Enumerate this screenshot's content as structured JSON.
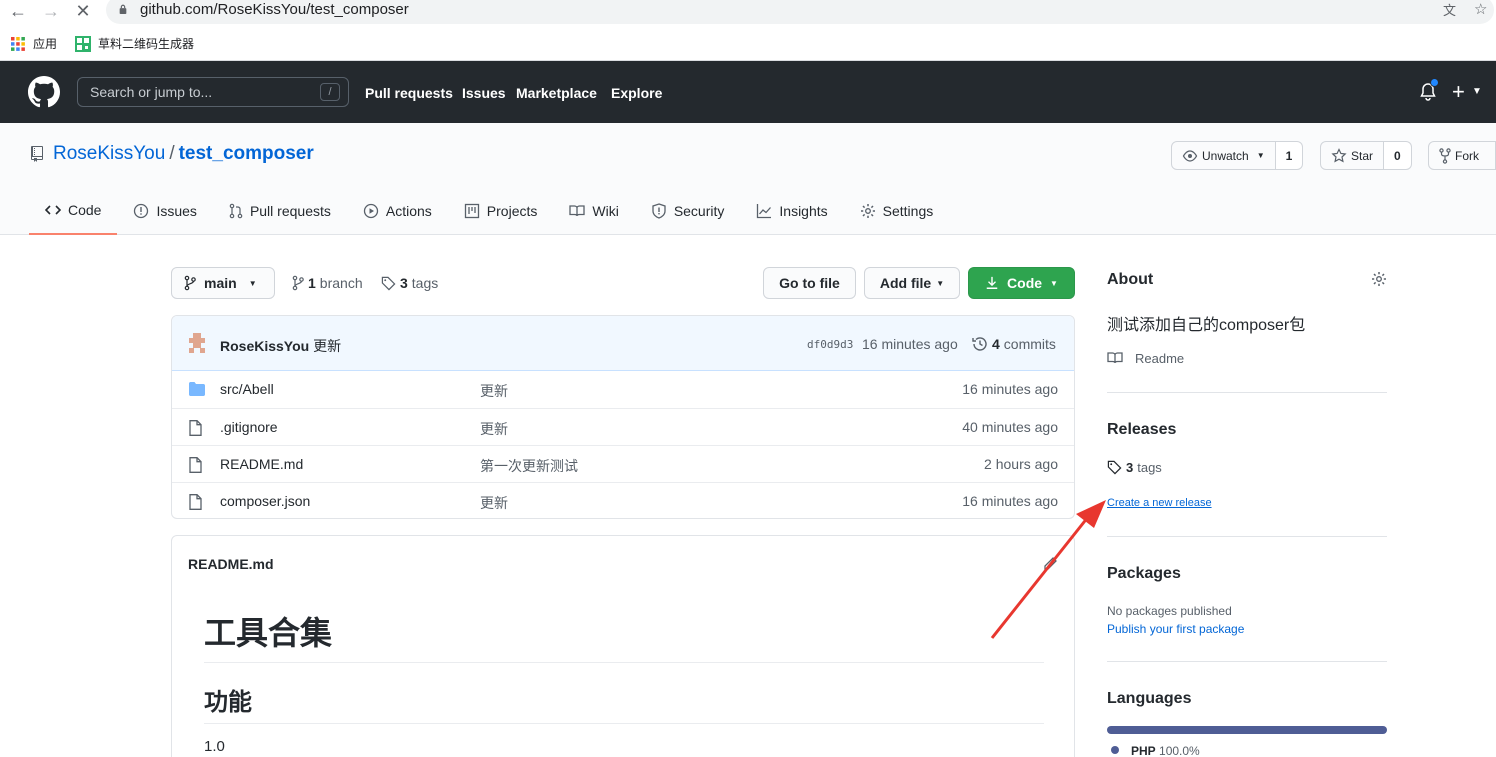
{
  "browser": {
    "url": "github.com/RoseKissYou/test_composer",
    "bookmarks": [
      {
        "label": "应用"
      },
      {
        "label": "草料二维码生成器"
      }
    ]
  },
  "header": {
    "search_placeholder": "Search or jump to...",
    "search_shortcut": "/",
    "nav": [
      "Pull requests",
      "Issues",
      "Marketplace",
      "Explore"
    ],
    "plus_label": "+"
  },
  "repo": {
    "owner": "RoseKissYou",
    "separator": "/",
    "name": "test_composer",
    "unwatch_label": "Unwatch",
    "watch_count": "1",
    "star_label": "Star",
    "star_count": "0",
    "fork_label": "Fork",
    "tabs": [
      {
        "label": "Code",
        "active": true
      },
      {
        "label": "Issues"
      },
      {
        "label": "Pull requests"
      },
      {
        "label": "Actions"
      },
      {
        "label": "Projects"
      },
      {
        "label": "Wiki"
      },
      {
        "label": "Security"
      },
      {
        "label": "Insights"
      },
      {
        "label": "Settings"
      }
    ]
  },
  "toolbar": {
    "branch": "main",
    "branch_count": "1",
    "branch_word": "branch",
    "tag_count": "3",
    "tag_word": "tags",
    "go_to_file": "Go to file",
    "add_file": "Add file",
    "code": "Code"
  },
  "commit": {
    "author": "RoseKissYou",
    "message": "更新",
    "sha": "df0d9d3",
    "time": "16 minutes ago",
    "count": "4",
    "count_word": "commits"
  },
  "files": [
    {
      "type": "folder",
      "name": "src/Abell",
      "message": "更新",
      "time": "16 minutes ago"
    },
    {
      "type": "file",
      "name": ".gitignore",
      "message": "更新",
      "time": "40 minutes ago"
    },
    {
      "type": "file",
      "name": "README.md",
      "message": "第一次更新测试",
      "time": "2 hours ago"
    },
    {
      "type": "file",
      "name": "composer.json",
      "message": "更新",
      "time": "16 minutes ago"
    }
  ],
  "readme": {
    "title": "README.md",
    "h1": "工具合集",
    "h2": "功能",
    "p": "1.0"
  },
  "sidebar": {
    "about_title": "About",
    "description": "测试添加自己的composer包",
    "readme_label": "Readme",
    "releases_title": "Releases",
    "tags_count": "3",
    "tags_word": "tags",
    "create_release": "Create a new release",
    "packages_title": "Packages",
    "no_packages": "No packages published",
    "publish_package": "Publish your first package",
    "languages_title": "Languages",
    "language": "PHP",
    "language_pct": "100.0%"
  },
  "colors": {
    "header_bg": "#24292e",
    "link": "#0366d6",
    "code_button": "#2ea44f",
    "active_tab": "#f9826c",
    "php": "#4F5D95",
    "annotation_arrow": "#e8372f"
  }
}
